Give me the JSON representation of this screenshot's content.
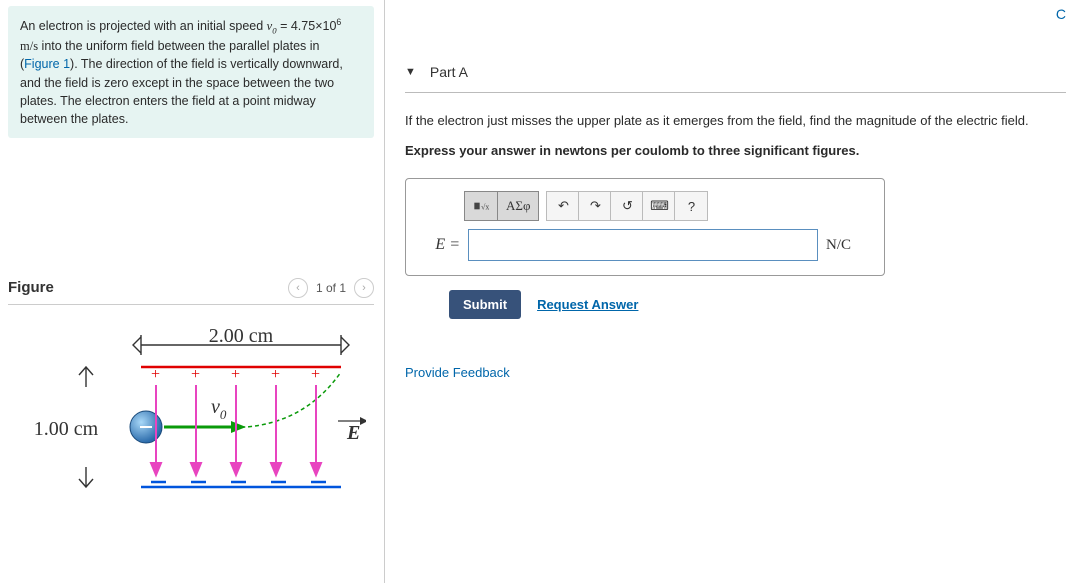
{
  "problem": {
    "intro_pre": "An electron is projected with an initial speed ",
    "v0_symbol": "v",
    "v0_sub": "0",
    "equals": " = ",
    "v0_value": "4.75×10",
    "v0_exp": "6",
    "v0_units": " m/s",
    "intro_mid": " into the uniform field between the parallel plates in (",
    "figure_link": "Figure 1",
    "intro_post": "). The direction of the field is vertically downward, and the field is zero except in the space between the two plates. The electron enters the field at a point midway between the plates."
  },
  "figure": {
    "title": "Figure",
    "counter": "1 of 1",
    "width_label": "2.00 cm",
    "height_label": "1.00 cm",
    "velocity_symbol": "v",
    "velocity_sub": "0",
    "field_symbol": "E"
  },
  "part": {
    "name": "Part A",
    "question": "If the electron just misses the upper plate as it emerges from the field, find the magnitude of the electric field.",
    "instruction": "Express your answer in newtons per coulomb to three significant figures.",
    "var_label": "E =",
    "units": "N/C",
    "toolbar": {
      "templates": "■√x",
      "greek": "ΑΣφ",
      "undo": "↶",
      "redo": "↷",
      "reset": "↺",
      "keyboard": "⌨",
      "help": "?"
    },
    "submit": "Submit",
    "request": "Request Answer"
  },
  "feedback_link": "Provide Feedback",
  "top_right": "C"
}
